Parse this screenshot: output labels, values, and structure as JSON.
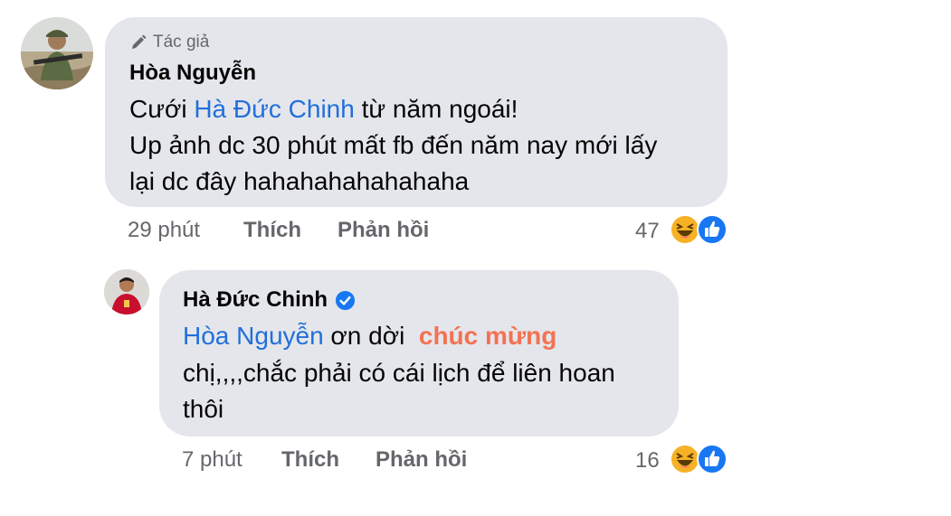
{
  "comments": [
    {
      "author_tag": "Tác giả",
      "author": "Hòa Nguyễn",
      "line1_pre": "Cưới ",
      "line1_mention": "Hà Đức Chinh",
      "line1_post": " từ năm ngoái!",
      "line2": "Up ảnh dc 30 phút mất fb đến năm nay mới lấy",
      "line3": "lại dc đây hahahahahahahaha",
      "time": "29 phút",
      "like_label": "Thích",
      "reply_label": "Phản hồi",
      "reaction_count": "47"
    },
    {
      "author": "Hà Đức Chinh",
      "line1_mention": "Hòa Nguyễn",
      "line1_mid": " ơn dời  ",
      "line1_highlight": "chúc mừng",
      "line2": "chị,,,,chắc phải có cái lịch để liên hoan",
      "line3": "thôi",
      "time": "7 phút",
      "like_label": "Thích",
      "reply_label": "Phản hồi",
      "reaction_count": "16"
    }
  ],
  "icons": [
    "pencil-icon",
    "verified-badge-icon",
    "haha-reaction-icon",
    "like-reaction-icon"
  ],
  "colors": {
    "bubble": "#e4e6eb",
    "mention": "#216fdb",
    "highlight": "#f37254",
    "meta": "#65676b",
    "like": "#1877f2",
    "haha": "#f7b125",
    "verified": "#1877f2"
  }
}
